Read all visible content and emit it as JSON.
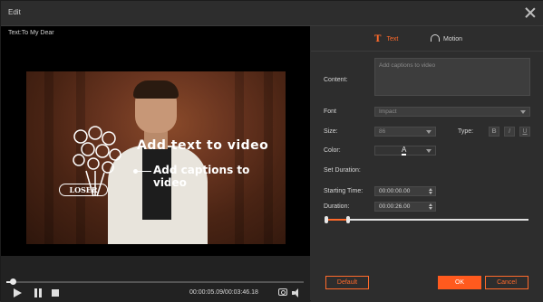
{
  "window": {
    "title": "Edit"
  },
  "preview": {
    "label": "Text:To My Dear",
    "overlay_text_1": "Add text to video",
    "overlay_text_2": "Add captions to video",
    "banner_text": "LOSER"
  },
  "player": {
    "time": "00:00:05.09/00:03:46.18",
    "progress_fraction": 0.02
  },
  "tabs": [
    {
      "label": "Text",
      "active": true
    },
    {
      "label": "Motion",
      "active": false
    }
  ],
  "form": {
    "content_label": "Content:",
    "content_placeholder": "Add captions to video",
    "font_label": "Font",
    "font_value": "Impact",
    "size_label": "Size:",
    "size_value": "86",
    "type_label": "Type:",
    "type_buttons": [
      "B",
      "I",
      "U"
    ],
    "color_label": "Color:",
    "color_glyph": "A",
    "set_duration_label": "Set Duration:",
    "starting_time_label": "Starting Time:",
    "starting_time_value": "00:00:00.00",
    "duration_label": "Duration:",
    "duration_value": "00:00:26.00"
  },
  "buttons": {
    "default": "Default",
    "ok": "OK",
    "cancel": "Cancel"
  },
  "colors": {
    "accent": "#ff6a2b",
    "panel": "#2d2d2d",
    "input": "#3d3d3d"
  }
}
